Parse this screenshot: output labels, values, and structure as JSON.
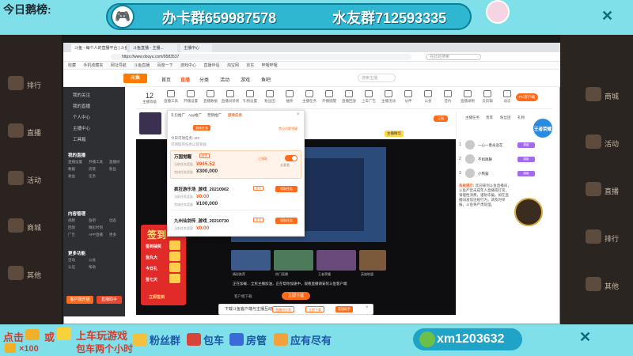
{
  "overlay": {
    "today_rank": "今日鹅榜:",
    "banner_left": "办卡群659987578",
    "banner_right": "水友群712593335",
    "bottom_click": "点击",
    "bottom_or": "或",
    "bottom_count": "×100",
    "bottom_line1": "上车玩游戏",
    "bottom_line2": "包车两个小时",
    "chips": [
      "粉丝群",
      "包车",
      "房管",
      "应有尽有"
    ],
    "contact": "xm1203632",
    "colors": {
      "frame": "#7fe0ea",
      "banner": "#2fb6d1",
      "accent_red": "#d73b2e"
    }
  },
  "browser": {
    "tabs": [
      "斗鱼 - 每个人的直播平台 | 斗鱼...",
      "斗鱼直播 - 主播...",
      "主播中心"
    ],
    "url": "https://www.douyu.com/9583537",
    "search_placeholder": "在此处搜索",
    "bookmarks": [
      "收藏",
      "手机收藏夹",
      "网址导航",
      "斗鱼直播",
      "百度一下",
      "游戏中心",
      "直播伴侣",
      "淘宝网",
      "京东",
      "哔哩哔哩"
    ]
  },
  "site": {
    "logo": "斗鱼",
    "nav": [
      {
        "label": "首页",
        "active": false
      },
      {
        "label": "直播",
        "active": true
      },
      {
        "label": "分类",
        "active": false
      },
      {
        "label": "活动",
        "active": false
      },
      {
        "label": "游戏",
        "active": false
      },
      {
        "label": "鱼吧",
        "active": false
      }
    ],
    "search_placeholder": "搜索主播"
  },
  "toolbar": {
    "level": "12",
    "level_caption": "主播等级",
    "tools": [
      "直播工具",
      "开播设置",
      "直播数据",
      "直播间装修",
      "礼物设置",
      "粉丝团",
      "抽奖",
      "主播任务",
      "开播提醒",
      "直播回放",
      "上车广告",
      "主播活动",
      "伙伴",
      "公会",
      "签约",
      "直播录制",
      "云剪辑",
      "动态",
      "礼物道具",
      "更多"
    ],
    "pc_button": "PC客户端"
  },
  "sidebar": {
    "items": [
      "我的关注",
      "我的直播",
      "个人中心",
      "主播中心",
      "工具箱"
    ],
    "section_live": "我的直播",
    "live_grid": [
      "直播设置",
      "开播工具",
      "直播间",
      "数据",
      "房管",
      "粉丝",
      "收益",
      "任务"
    ],
    "section_manage": "内容管理",
    "manage_grid": [
      "视频",
      "鱼吧",
      "动态",
      "回放",
      "精彩时刻",
      "广告",
      "APP直播",
      "更多"
    ],
    "section_more": "更多功能",
    "more_grid": [
      "活动",
      "公会",
      "认证",
      "帮助"
    ],
    "btn_left": "客户端开播",
    "btn_right": "直播助手"
  },
  "room": {
    "tag": "主播精华",
    "subscribe": "订阅",
    "download_line": "正在加载... 全民主播加油，正在帮你加速中，观看直播请安装斗鱼客户端",
    "download_btn": "立即下载",
    "download_link": "客户端下载",
    "thumbs": [
      "精彩推荐",
      "热门直播",
      "王者荣耀",
      "英雄联盟"
    ]
  },
  "promo": {
    "title": "签到",
    "rows": [
      "签到抽奖",
      "鱼丸大",
      "今日礼",
      "签七天"
    ],
    "button": "立即签到"
  },
  "card": {
    "tabs": [
      {
        "label": "礼包推广",
        "active": false
      },
      {
        "label": "App推广",
        "active": false
      },
      {
        "label": "营销推广",
        "active": false
      },
      {
        "label": "游戏任务",
        "active": true
      }
    ],
    "chip": "游戏任务",
    "hint": "常见问题答疑",
    "note": "今日可领任务: 2/3",
    "note2": "可领取的任务以及奖励",
    "items": [
      {
        "name": "万国觉醒",
        "tag": "新手",
        "label1": "当前任务奖励",
        "value1": "¥945.52",
        "label2": "完成任务奖励",
        "value2": "¥300,000",
        "check": "已领取",
        "link": "去看看",
        "highlight": true
      },
      {
        "name": "疯狂游乐场_游戏_20210902",
        "tag": "新手",
        "label1": "当前任务奖励",
        "value1": "¥0.00",
        "label2": "完成任务奖励",
        "value2": "¥100,000",
        "button": "领取任务",
        "highlight": false
      },
      {
        "name": "九州仙剑传_游戏_20210730",
        "tag": "新手",
        "label1": "当前任务奖励",
        "value1": "¥0.00",
        "button": "领取任务",
        "highlight": false
      }
    ]
  },
  "right_panel": {
    "tabs": [
      "主播任务",
      "贵宾",
      "粉丝团",
      "礼物"
    ],
    "ranks": [
      {
        "rank": "1",
        "name": "一心一意永远在",
        "badge": "超级"
      },
      {
        "rank": "2",
        "name": "不如跳舞",
        "badge": "超级"
      },
      {
        "rank": "3",
        "name": "小熊猫",
        "badge": "超级"
      }
    ],
    "notice_label": "系统提示:",
    "notice": "欢迎来到斗鱼直播间，斗鱼严禁未成年人直播或打赏，请理性消费，谨防诈骗。如在直播间发现违规行为，请及时举报，斗鱼将严肃处理。",
    "live_badge": "王者荣耀"
  },
  "download_banner": {
    "text": "下载斗鱼客户端与主播互动",
    "btn1": "直播间分享",
    "btn2": "立即下载",
    "btn3": "直播助手"
  },
  "left_overlay": [
    "排行",
    "直播",
    "活动",
    "商城",
    "其他"
  ],
  "right_overlay": [
    "商城",
    "活动",
    "直播",
    "排行",
    "其他"
  ]
}
